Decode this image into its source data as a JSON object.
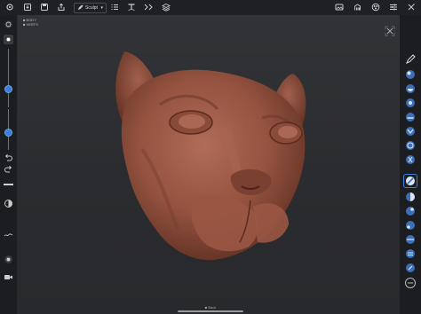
{
  "topbar": {
    "icons": [
      "gear-icon",
      "download-icon",
      "save-icon",
      "share-icon",
      "pen-icon",
      "list-icon",
      "sculpt-text-icon",
      "symmetry-icon",
      "layers-icon",
      "image-icon",
      "scene-icon",
      "material-icon",
      "settings-sliders-icon",
      "tools-icon"
    ],
    "tool_name": "Sculpt"
  },
  "info": {
    "line1": "■ BODY",
    "line2": "■ VERTS"
  },
  "footer": {
    "label": "■ Back"
  },
  "colors": {
    "accent": "#3b7dd8",
    "clay": "#9a5a48",
    "background": "#2a2b2e",
    "panel": "#1c1d20"
  },
  "left_bar": {
    "sliders": [
      {
        "name": "radius",
        "value": 0.55
      },
      {
        "name": "intensity",
        "value": 0.35
      }
    ]
  }
}
